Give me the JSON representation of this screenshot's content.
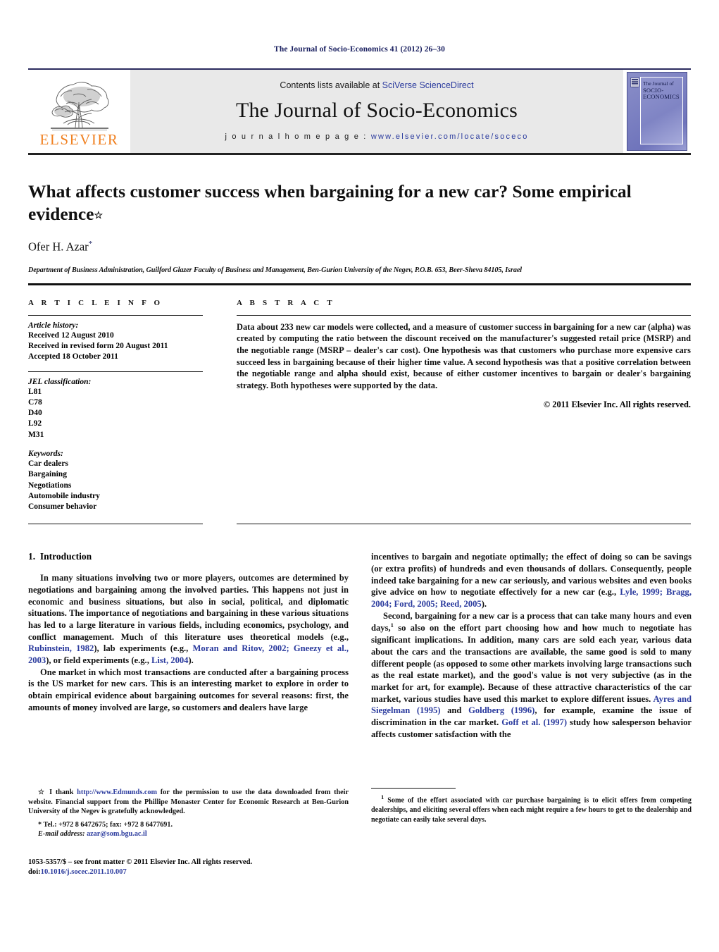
{
  "running_head": "The Journal of Socio-Economics 41 (2012) 26–30",
  "masthead": {
    "publisher_name": "ELSEVIER",
    "contents_prefix": "Contents lists available at ",
    "contents_link": "SciVerse ScienceDirect",
    "journal_title": "The Journal of Socio-Economics",
    "homepage_label": "j o u r n a l   h o m e p a g e :  ",
    "homepage_url": "www.elsevier.com/locate/soceco",
    "cover": {
      "line1": "The Journal of",
      "line2": "SOCIO-",
      "line3": "ECONOMICS"
    }
  },
  "article": {
    "title": "What affects customer success when bargaining for a new car? Some empirical evidence",
    "title_marker": "☆",
    "author": "Ofer H. Azar",
    "author_marker": "*",
    "affiliation": "Department of Business Administration, Guilford Glazer Faculty of Business and Management, Ben-Gurion University of the Negev, P.O.B. 653, Beer-Sheva 84105, Israel"
  },
  "article_info": {
    "heading": "A R T I C L E   I N F O",
    "history_label": "Article history:",
    "history": [
      "Received 12 August 2010",
      "Received in revised form 20 August 2011",
      "Accepted 18 October 2011"
    ],
    "jel_label": "JEL classification:",
    "jel": [
      "L81",
      "C78",
      "D40",
      "L92",
      "M31"
    ],
    "keywords_label": "Keywords:",
    "keywords": [
      "Car dealers",
      "Bargaining",
      "Negotiations",
      "Automobile industry",
      "Consumer behavior"
    ]
  },
  "abstract": {
    "heading": "A B S T R A C T",
    "text": "Data about 233 new car models were collected, and a measure of customer success in bargaining for a new car (alpha) was created by computing the ratio between the discount received on the manufacturer's suggested retail price (MSRP) and the negotiable range (MSRP – dealer's car cost). One hypothesis was that customers who purchase more expensive cars succeed less in bargaining because of their higher time value. A second hypothesis was that a positive correlation between the negotiable range and alpha should exist, because of either customer incentives to bargain or dealer's bargaining strategy. Both hypotheses were supported by the data.",
    "copyright": "© 2011 Elsevier Inc. All rights reserved."
  },
  "body": {
    "section_number": "1.",
    "section_title": "Introduction",
    "left_para_1_a": "In many situations involving two or more players, outcomes are determined by negotiations and bargaining among the involved parties. This happens not just in economic and business situations, but also in social, political, and diplomatic situations. The importance of negotiations and bargaining in these various situations has led to a large literature in various fields, including economics, psychology, and conflict management. Much of this literature uses theoretical models (e.g., ",
    "ref_rubinstein": "Rubinstein, 1982",
    "left_para_1_b": "), lab experiments (e.g., ",
    "ref_moran": "Moran and Ritov, 2002; Gneezy et al., 2003",
    "left_para_1_c": "), or field experiments (e.g., ",
    "ref_list": "List, 2004",
    "left_para_1_d": ").",
    "left_para_2": "One market in which most transactions are conducted after a bargaining process is the US market for new cars. This is an interesting market to explore in order to obtain empirical evidence about bargaining outcomes for several reasons: first, the amounts of money involved are large, so customers and dealers have large",
    "right_para_1_a": "incentives to bargain and negotiate optimally; the effect of doing so can be savings (or extra profits) of hundreds and even thousands of dollars. Consequently, people indeed take bargaining for a new car seriously, and various websites and even books give advice on how to negotiate effectively for a new car (e.g., ",
    "ref_lyle": "Lyle, 1999; Bragg, 2004; Ford, 2005; Reed, 2005",
    "right_para_1_b": ").",
    "right_para_2_a": "Second, bargaining for a new car is a process that can take many hours and even days,",
    "right_fn_marker": "1",
    "right_para_2_b": " so also on the effort part choosing how and how much to negotiate has significant implications. In addition, many cars are sold each year, various data about the cars and the transactions are available, the same good is sold to many different people (as opposed to some other markets involving large transactions such as the real estate market), and the good's value is not very subjective (as in the market for art, for example). Because of these attractive characteristics of the car market, various studies have used this market to explore different issues. ",
    "ref_ayres": "Ayres and Siegelman (1995)",
    "right_para_2_c": " and ",
    "ref_goldberg": "Goldberg (1996)",
    "right_para_2_d": ", for example, examine the issue of discrimination in the car market. ",
    "ref_goff": "Goff et al. (1997)",
    "right_para_2_e": " study how salesperson behavior affects customer satisfaction with the"
  },
  "footnotes": {
    "star_marker": "☆",
    "star_text_a": " I thank ",
    "star_link": "http://www.Edmunds.com",
    "star_text_b": " for the permission to use the data downloaded from their website. Financial support from the Phillipe Monaster Center for Economic Research at Ben-Gurion University of the Negev is gratefully acknowledged.",
    "tel_marker": "*",
    "tel_text": " Tel.: +972 8 6472675; fax: +972 8 6477691.",
    "email_label": "E-mail address:",
    "email_value": "azar@som.bgu.ac.il",
    "right_marker": "1",
    "right_text": " Some of the effort associated with car purchase bargaining is to elicit offers from competing dealerships, and eliciting several offers when each might require a few hours to get to the dealership and negotiate can easily take several days.",
    "issn_line": "1053-5357/$ – see front matter © 2011 Elsevier Inc. All rights reserved.",
    "doi_label": "doi:",
    "doi_value": "10.1016/j.socec.2011.10.007"
  },
  "colors": {
    "link": "#2b3b9e",
    "elsevier_orange": "#f08020",
    "banner_gray": "#e9e9e9",
    "running_head": "#1a2060"
  }
}
